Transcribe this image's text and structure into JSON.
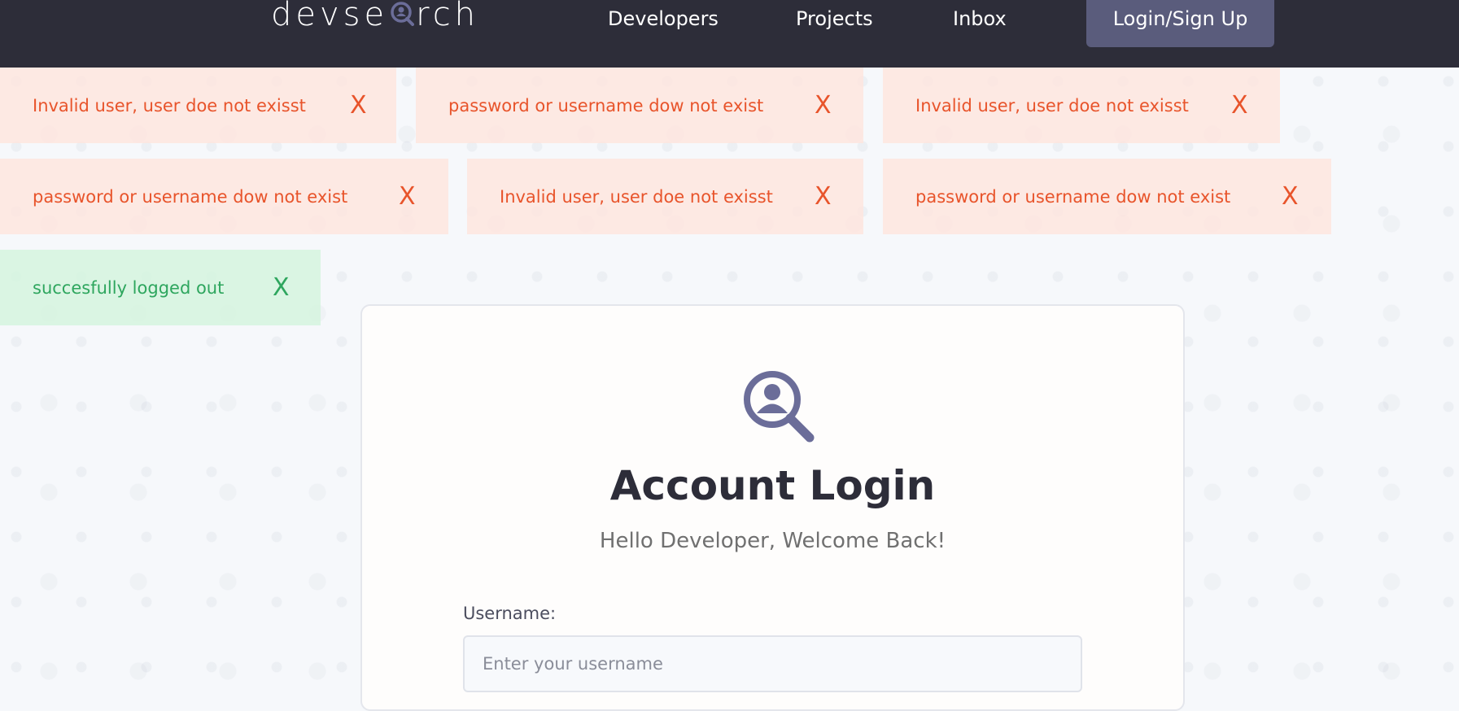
{
  "navbar": {
    "logo_left": "devse",
    "logo_right": "rch",
    "links": [
      "Developers",
      "Projects",
      "Inbox"
    ],
    "login_label": "Login/Sign Up"
  },
  "alerts": [
    {
      "type": "error",
      "message": "Invalid user, user doe not exisst",
      "close": "X"
    },
    {
      "type": "error",
      "message": "password or username dow not exist",
      "close": "X"
    },
    {
      "type": "error",
      "message": "Invalid user, user doe not exisst",
      "close": "X"
    },
    {
      "type": "error",
      "message": "password or username dow not exist",
      "close": "X"
    },
    {
      "type": "error",
      "message": "Invalid user, user doe not exisst",
      "close": "X"
    },
    {
      "type": "error",
      "message": "password or username dow not exist",
      "close": "X"
    },
    {
      "type": "success",
      "message": "succesfully logged out",
      "close": "X"
    }
  ],
  "card": {
    "icon": "user-search-icon",
    "title": "Account Login",
    "subtitle": "Hello Developer, Welcome Back!",
    "username_label": "Username:",
    "username_placeholder": "Enter your username",
    "username_value": ""
  },
  "colors": {
    "navbar_bg": "#2d2d39",
    "accent": "#5a5c7c",
    "error_text": "#e8542b",
    "success_text": "#2ea65e"
  }
}
